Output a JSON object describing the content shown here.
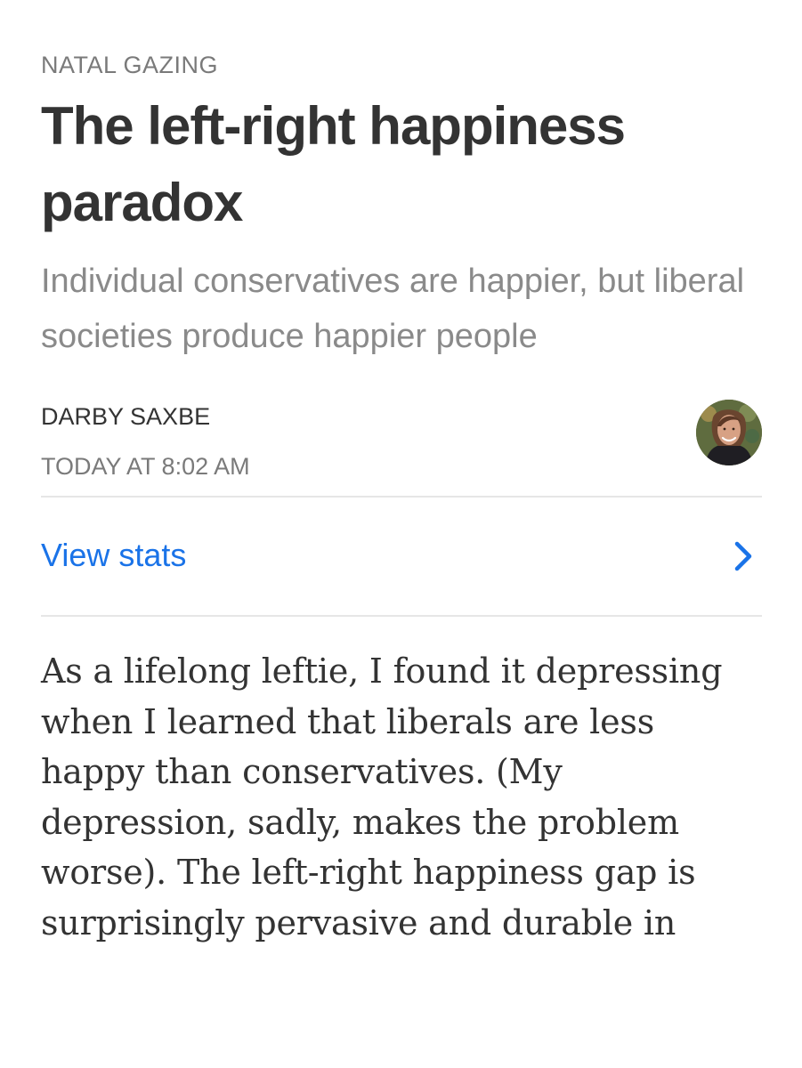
{
  "article": {
    "section": "NATAL GAZING",
    "title": "The left-right happiness paradox",
    "subtitle": "Individual conservatives are happier, but liberal societies produce happier people",
    "author": "DARBY SAXBE",
    "timestamp": "TODAY AT 8:02 AM",
    "body": "As a lifelong leftie, I found it depressing when I learned that liberals are less happy than conservatives. (My depression, sadly, makes the problem worse). The left-right happiness gap is surprisingly pervasive and durable in"
  },
  "stats": {
    "label": "View stats"
  },
  "icons": {
    "avatar": "author-avatar",
    "chevron": "chevron-right-icon"
  },
  "colors": {
    "link": "#1a73e8",
    "muted": "#7a7a7a",
    "text": "#333333",
    "divider": "#e6e6e6"
  }
}
